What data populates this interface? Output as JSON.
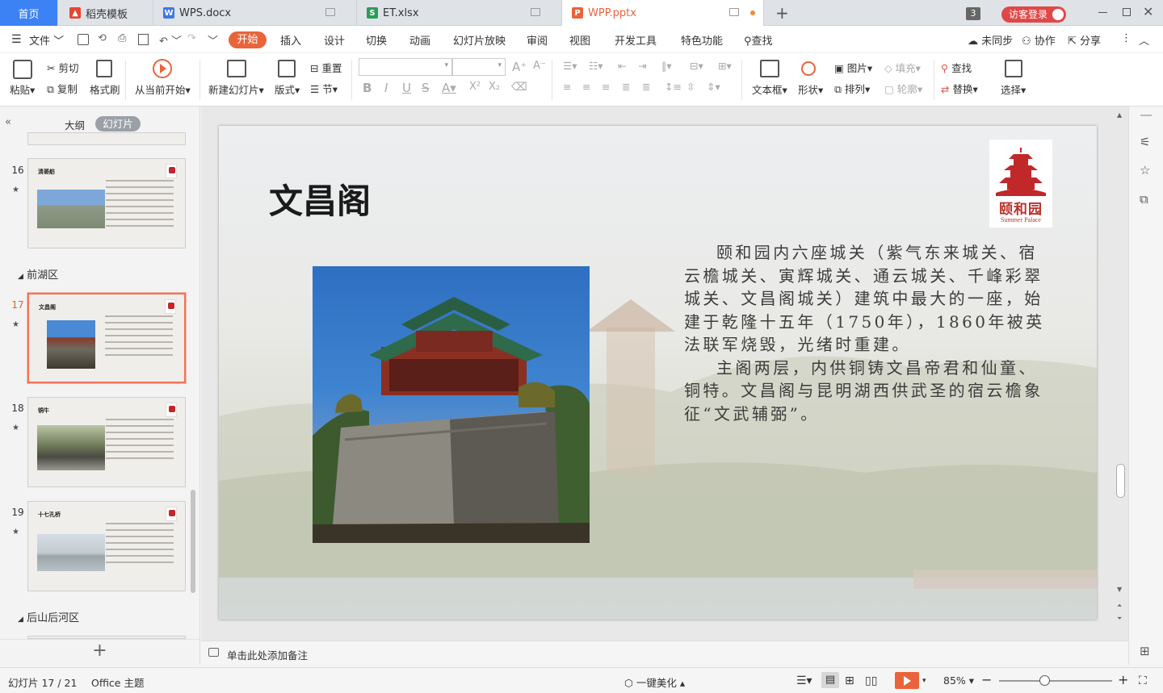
{
  "tabs": [
    {
      "label": "首页",
      "active": true
    },
    {
      "label": "稻壳模板"
    },
    {
      "label": "WPS.docx"
    },
    {
      "label": "ET.xlsx"
    },
    {
      "label": "WPP.pptx",
      "current": true
    }
  ],
  "titlebar": {
    "badge": "3",
    "login": "访客登录"
  },
  "menu": {
    "file": "文件",
    "items": [
      "开始",
      "插入",
      "设计",
      "切换",
      "动画",
      "幻灯片放映",
      "审阅",
      "视图",
      "开发工具",
      "特色功能"
    ],
    "search": "查找",
    "sync": "未同步",
    "collab": "协作",
    "share": "分享"
  },
  "toolbar": {
    "paste": "粘贴",
    "cut": "剪切",
    "copy": "复制",
    "format_painter": "格式刷",
    "play_from_current": "从当前开始",
    "new_slide": "新建幻灯片",
    "layout": "版式",
    "reset": "重置",
    "section": "节",
    "textbox": "文本框",
    "shape": "形状",
    "picture": "图片",
    "fill": "填充",
    "arrange": "排列",
    "outline": "轮廓",
    "find": "查找",
    "replace": "替换",
    "select": "选择"
  },
  "panel": {
    "tab_outline": "大纲",
    "tab_slides": "幻灯片",
    "sections": [
      "前湖区",
      "后山后河区"
    ],
    "slides": [
      {
        "num": "16",
        "title": "清晏舫"
      },
      {
        "num": "17",
        "title": "文昌阁",
        "selected": true
      },
      {
        "num": "18",
        "title": "铜牛"
      },
      {
        "num": "19",
        "title": "十七孔桥"
      }
    ]
  },
  "slide": {
    "title": "文昌阁",
    "para1": "颐和园内六座城关（紫气东来城关、宿云檐城关、寅辉城关、通云城关、千峰彩翠城关、文昌阁城关）建筑中最大的一座，始建于乾隆十五年（1750年），1860年被英法联军烧毁，光绪时重建。",
    "para2": "主阁两层，内供铜铸文昌帝君和仙童、铜特。文昌阁与昆明湖西供武圣的宿云檐象征“文武辅弼”。",
    "logo_cn": "颐和园",
    "logo_en": "Summer Palace"
  },
  "notes_placeholder": "单击此处添加备注",
  "status": {
    "slide_counter": "幻灯片 17 / 21",
    "theme": "Office 主题",
    "beautify": "一键美化",
    "zoom": "85%"
  },
  "colors": {
    "accent": "#e9643b",
    "logo_red": "#c0282a",
    "tab_bg": "#dfe3e8"
  }
}
